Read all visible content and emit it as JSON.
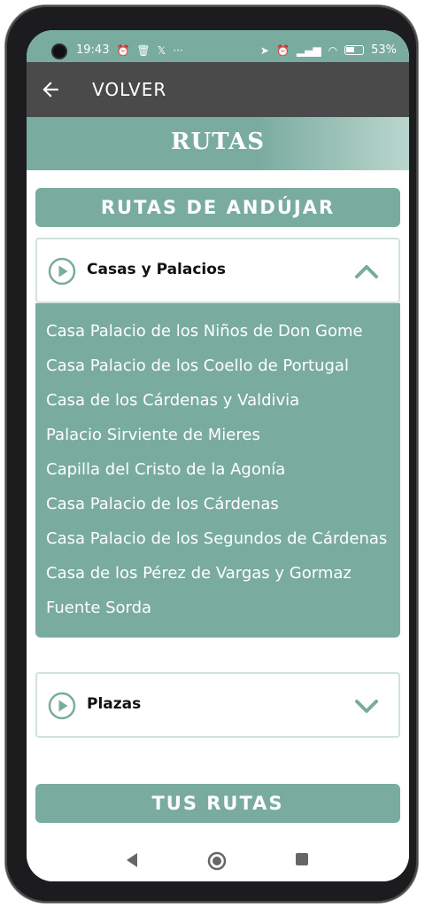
{
  "status_bar": {
    "time": "19:43",
    "left_icons": [
      "alarm-icon",
      "trash-icon",
      "x-icon",
      "more-icon"
    ],
    "right_icons": [
      "location-icon",
      "alarm-icon",
      "signal-icon",
      "wifi-icon",
      "battery-icon"
    ],
    "battery": "53%"
  },
  "app_bar": {
    "back_label": "VOLVER"
  },
  "banner": {
    "title": "RUTAS"
  },
  "routes_section": {
    "title": "RUTAS DE ANDÚJAR",
    "groups": [
      {
        "label": "Casas y Palacios",
        "expanded": true,
        "items": [
          "Casa Palacio de los Niños de Don Gome",
          "Casa Palacio de los Coello de Portugal",
          "Casa de los Cárdenas y Valdivia",
          "Palacio Sirviente de Mieres",
          "Capilla del Cristo de la Agonía",
          "Casa Palacio de los Cárdenas",
          "Casa Palacio de los Segundos de Cárdenas",
          "Casa de los Pérez de Vargas y Gormaz",
          "Fuente Sorda"
        ]
      },
      {
        "label": "Plazas",
        "expanded": false,
        "items": []
      }
    ]
  },
  "your_routes": {
    "title": "TUS RUTAS"
  },
  "colors": {
    "accent": "#7aab9f",
    "appbar": "#4a4a4a",
    "border": "#cfe3dc"
  }
}
